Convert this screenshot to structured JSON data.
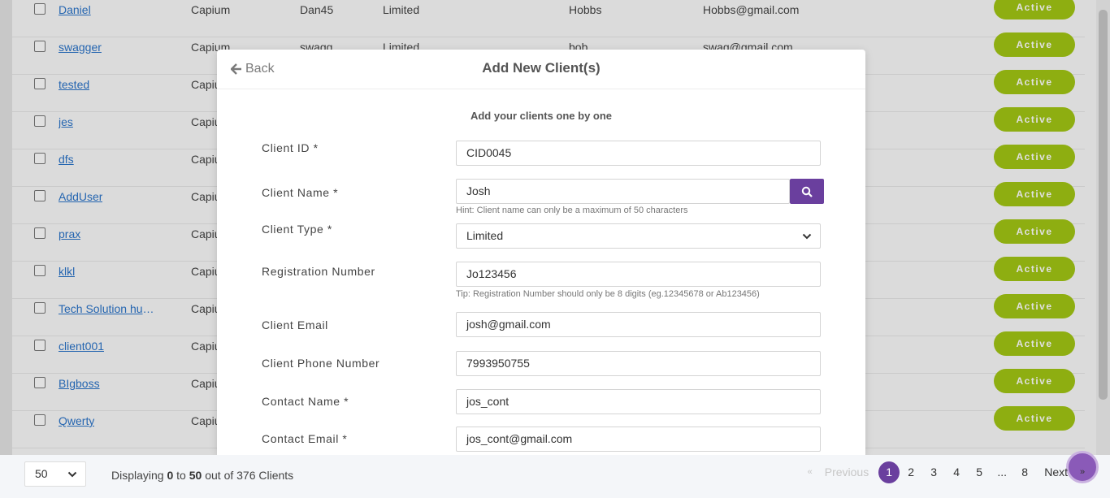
{
  "client_rows": [
    {
      "name": "Daniel",
      "company": "Capium",
      "user": "Dan45",
      "type": "Limited",
      "contact": "Hobbs",
      "email": "Hobbs@gmail.com",
      "status": "Active"
    },
    {
      "name": "swagger",
      "company": "Capium",
      "user": "swagg",
      "type": "Limited",
      "contact": "bob",
      "email": "swag@gmail.com",
      "status": "Active"
    },
    {
      "name": "tested",
      "company": "Capiu",
      "status": "Active"
    },
    {
      "name": "jes",
      "company": "Capiu",
      "status": "Active"
    },
    {
      "name": "dfs",
      "company": "Capiu",
      "status": "Active"
    },
    {
      "name": "AddUser",
      "company": "Capiu",
      "status": "Active"
    },
    {
      "name": "prax",
      "company": "Capiu",
      "status": "Active"
    },
    {
      "name": "klkl",
      "company": "Capiu",
      "status": "Active"
    },
    {
      "name": "Tech Solution hub ...",
      "company": "Capiu",
      "status": "Active"
    },
    {
      "name": "client001",
      "company": "Capiu",
      "status": "Active"
    },
    {
      "name": "BIgboss",
      "company": "Capiu",
      "status": "Active"
    },
    {
      "name": "Qwerty",
      "company": "Capiu",
      "status": "Active"
    }
  ],
  "modal": {
    "back_label": "Back",
    "title": "Add New Client(s)",
    "subtitle": "Add your clients one by one",
    "fields": {
      "client_id": {
        "label": "Client ID *",
        "value": "CID0045"
      },
      "client_name": {
        "label": "Client Name *",
        "value": "Josh",
        "hint": "Hint: Client name can only be a maximum of 50 characters"
      },
      "client_type": {
        "label": "Client Type *",
        "value": "Limited"
      },
      "registration_number": {
        "label": "Registration Number",
        "value": "Jo123456",
        "hint": "Tip: Registration Number should only be 8 digits (eg.12345678 or Ab123456)"
      },
      "client_email": {
        "label": "Client Email",
        "value": "josh@gmail.com"
      },
      "client_phone": {
        "label": "Client Phone Number",
        "value": "7993950755"
      },
      "contact_name": {
        "label": "Contact Name *",
        "value": "jos_cont"
      },
      "contact_email": {
        "label": "Contact Email *",
        "value": "jos_cont@gmail.com"
      }
    }
  },
  "footer": {
    "page_size": "50",
    "display_prefix": "Displaying",
    "display_from": "0",
    "display_to_word": "to",
    "display_to": "50",
    "display_suffix": "out of 376 Clients",
    "prev_arrow": "«",
    "previous": "Previous",
    "pages": [
      "1",
      "2",
      "3",
      "4",
      "5",
      "...",
      "8"
    ],
    "next": "Next",
    "next_arrow": "»"
  },
  "colors": {
    "accent_purple": "#6a3f9e",
    "status_green": "#a2c614",
    "link_blue": "#2a73c9"
  }
}
